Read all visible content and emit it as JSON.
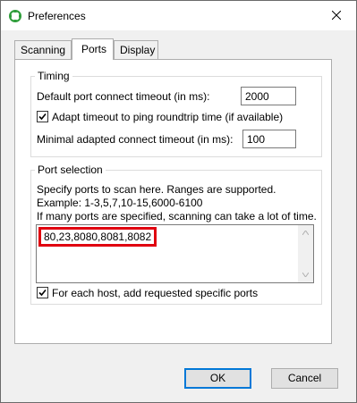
{
  "window": {
    "title": "Preferences"
  },
  "tabs": [
    {
      "label": "Scanning"
    },
    {
      "label": "Ports"
    },
    {
      "label": "Display"
    }
  ],
  "timing": {
    "legend": "Timing",
    "port_timeout_label": "Default port connect timeout (in ms):",
    "port_timeout_value": "2000",
    "adapt_label": "Adapt timeout to ping roundtrip time (if available)",
    "adapt_checked": true,
    "min_timeout_label": "Minimal adapted connect timeout (in ms):",
    "min_timeout_value": "100"
  },
  "port_selection": {
    "legend": "Port selection",
    "help_line1": "Specify ports to scan here. Ranges are supported.",
    "help_line2": "Example: 1-3,5,7,10-15,6000-6100",
    "help_line3": "If many ports are specified, scanning can take a lot of time.",
    "ports_value": "80,23,8080,8081,8082",
    "add_specific_label": "For each host, add requested specific ports",
    "add_specific_checked": true
  },
  "buttons": {
    "ok": "OK",
    "cancel": "Cancel"
  },
  "colors": {
    "highlight_box": "#e0000f",
    "default_button_border": "#0078d7"
  }
}
